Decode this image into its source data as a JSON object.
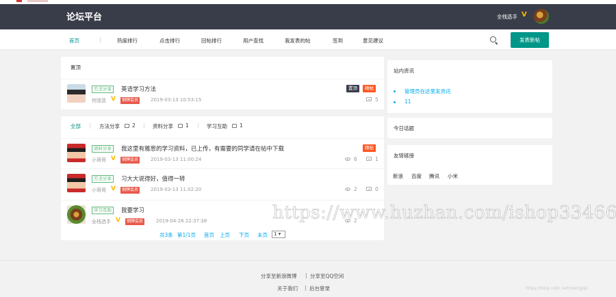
{
  "header": {
    "logo": "论坛平台",
    "user_name": "全栈选手",
    "user_v": "V"
  },
  "nav": {
    "items": [
      "首页",
      "热度排行",
      "点击排行",
      "回帖排行",
      "用户查找",
      "我发表的帖",
      "签到",
      "意见建议"
    ],
    "post_button": "发表新帖"
  },
  "top_panel": {
    "title": "置顶",
    "post": {
      "tag": "方法分享",
      "title": "英语学习方法",
      "author": "何弦弦",
      "vip": "钢牌会员",
      "time": "2019-03-13 10:53:15",
      "badges": [
        "置顶",
        "精帖"
      ],
      "comments": "5"
    }
  },
  "list_panel": {
    "filters": [
      {
        "label": "全部",
        "count": ""
      },
      {
        "label": "方法分享",
        "count": "2"
      },
      {
        "label": "资料分享",
        "count": "1"
      },
      {
        "label": "学习互助",
        "count": "1"
      }
    ],
    "posts": [
      {
        "tag": "资料分享",
        "title": "我这里有雅思的学习资料，已上传，有需要的同学请在帖中下载",
        "author": "小哥哥",
        "vip": "钢牌会员",
        "time": "2019-03-13 11:00:24",
        "badge": "精帖",
        "views": "6",
        "comments": "1"
      },
      {
        "tag": "方法分享",
        "title": "习大大说得好，值得一转",
        "author": "小哥哥",
        "vip": "钢牌会员",
        "time": "2019-03-13 11:02:20",
        "views": "2",
        "comments": "0"
      },
      {
        "tag": "学习互助",
        "title": "我要学习",
        "author": "全栈选手",
        "vip": "钢牌会员",
        "time": "2019-04-26 22:37:38",
        "views": "2",
        "comments": ""
      }
    ],
    "pager": {
      "total": "共3条",
      "page_info": "第1/1页",
      "first": "首页",
      "prev": "上页",
      "next": "下页",
      "last": "末页",
      "select_value": "1"
    }
  },
  "sidebar": {
    "news_title": "站内资讯",
    "news_items": [
      "管理员在这里发资讯",
      "11"
    ],
    "today_title": "今日话题",
    "friends_title": "友情链接",
    "friends": [
      "新浪",
      "百度",
      "腾讯",
      "小米"
    ]
  },
  "footer": {
    "row1": [
      "分享至新浪微博",
      "分享至QQ空间"
    ],
    "row2": [
      "关于我们",
      "后台登录"
    ],
    "sep": "|"
  },
  "watermark": "https://www.huzhan.com/ishop33466",
  "csdn_mark": "https://blog.csdn.net/mengjiqi"
}
